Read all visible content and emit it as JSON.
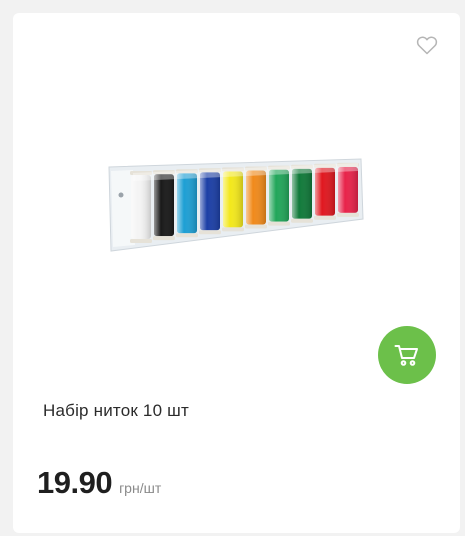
{
  "product": {
    "name": "Набір ниток 10 шт",
    "price": "19.90",
    "unit": "грн/шт",
    "thread_colors": [
      "#f4f4f4",
      "#1a1a1a",
      "#1e9fd4",
      "#1c3fa6",
      "#f3e81c",
      "#f08a1c",
      "#22a65a",
      "#117a3a",
      "#e01820",
      "#e8234a"
    ]
  },
  "colors": {
    "accent": "#6cc04a",
    "icon_gray": "#b5b5b5"
  },
  "icons": {
    "favorite": "heart-outline-icon",
    "cart": "shopping-cart-icon"
  }
}
